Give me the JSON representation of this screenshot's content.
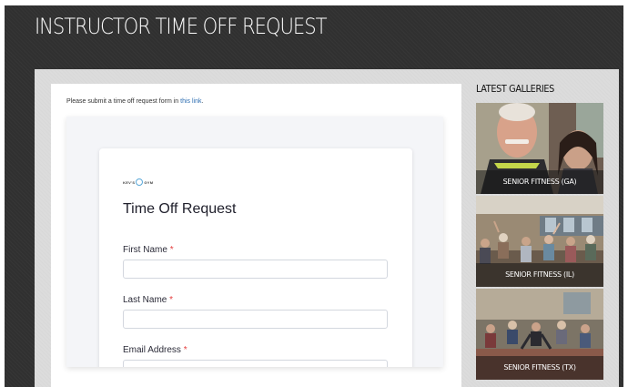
{
  "header": {
    "title": "INSTRUCTOR TIME OFF REQUEST"
  },
  "intro": {
    "text": "Please submit a time off request form in ",
    "link_text": "this link",
    "suffix": "."
  },
  "form": {
    "logo_left": "KEV'S",
    "logo_right": "GYM",
    "title": "Time Off Request",
    "required_marker": "*",
    "fields": [
      {
        "label": "First Name"
      },
      {
        "label": "Last Name"
      },
      {
        "label": "Email Address"
      }
    ]
  },
  "sidebar": {
    "heading": "LATEST GALLERIES",
    "galleries": [
      {
        "label": "SENIOR FITNESS (GA)"
      },
      {
        "label": "SENIOR FITNESS (IL)"
      },
      {
        "label": "SENIOR FITNESS (TX)"
      }
    ]
  },
  "colors": {
    "link": "#2b6cb0",
    "required": "#e53e3e",
    "header_bg": "#303030"
  }
}
